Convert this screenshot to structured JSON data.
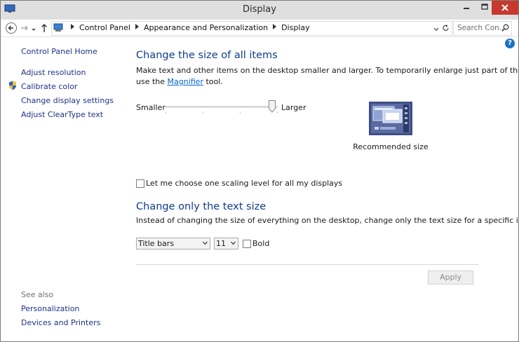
{
  "window": {
    "title": "Display",
    "icons": {
      "app": "display-icon",
      "minimize": "minimize-icon",
      "maximize": "maximize-icon",
      "close": "close-icon"
    },
    "close_color": "#c7382d"
  },
  "address_bar": {
    "breadcrumbs": [
      "Control Panel",
      "Appearance and Personalization",
      "Display"
    ],
    "search_placeholder": "Search Con..."
  },
  "sidebar": {
    "home_link": "Control Panel Home",
    "tasks": [
      "Adjust resolution",
      "Calibrate color",
      "Change display settings",
      "Adjust ClearType text"
    ],
    "see_also_label": "See also",
    "see_also": [
      "Personalization",
      "Devices and Printers"
    ]
  },
  "help_label": "?",
  "main": {
    "size_heading": "Change the size of all items",
    "size_desc_line1": "Make text and other items on the desktop smaller and larger. To temporarily enlarge just part of the screen,",
    "size_desc_pre": "use the ",
    "size_desc_link": "Magnifier",
    "size_desc_post": " tool.",
    "slider": {
      "min_label": "Smaller",
      "max_label": "Larger",
      "level": 1.0
    },
    "preview_caption": "Recommended size",
    "scaling_checkbox_label": "Let me choose one scaling level for all my displays",
    "text_heading": "Change only the text size",
    "text_desc": "Instead of changing the size of everything on the desktop, change only the text size for a specific item.",
    "item_select_value": "Title bars",
    "size_select_value": "11",
    "bold_label": "Bold",
    "apply_label": "Apply"
  },
  "colors": {
    "heading": "#0e3c8c",
    "link": "#1e3287",
    "accent": "#1c6fc7"
  }
}
